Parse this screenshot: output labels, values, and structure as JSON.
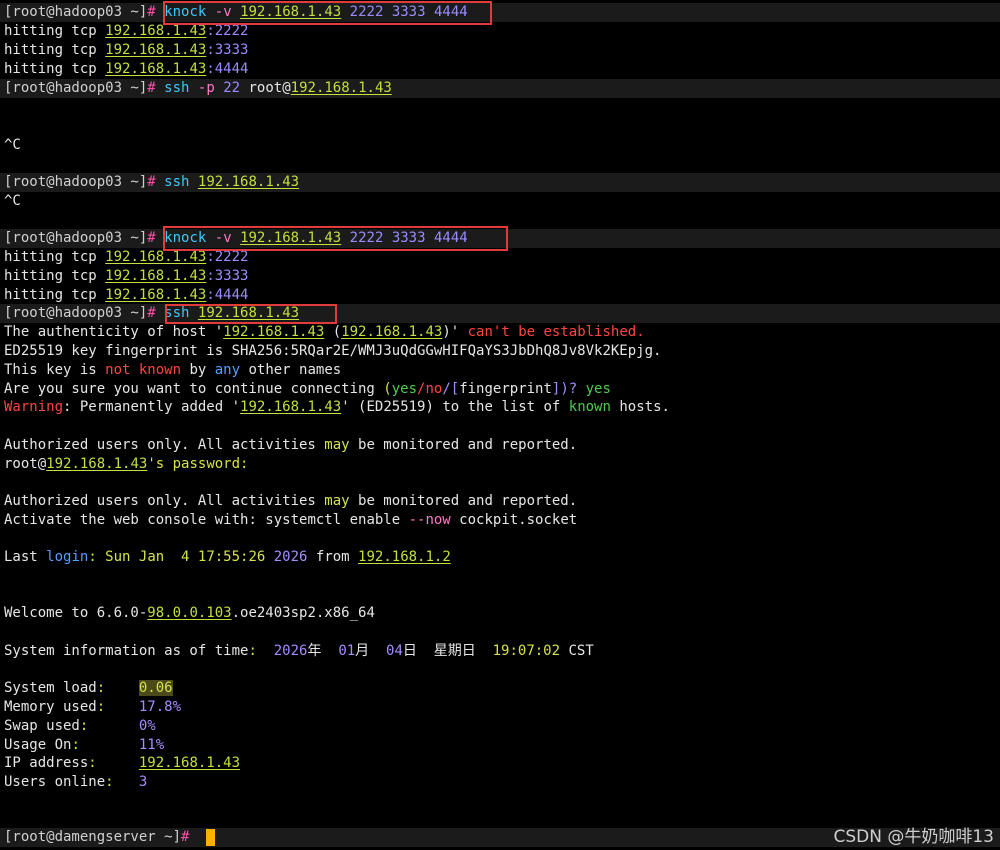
{
  "prompt": {
    "hadoop": "[root@hadoop03 ~]",
    "hash": "#",
    "dameng": "[root@damengserver ~]"
  },
  "commands": {
    "knock1": {
      "cmd": "knock",
      "opt": "-v",
      "ip": "192.168.1.43",
      "ports": [
        "2222",
        "3333",
        "4444"
      ]
    },
    "ssh1": {
      "cmd": "ssh",
      "opt": "-p",
      "port": "22",
      "user": "root@",
      "ip": "192.168.1.43"
    },
    "ssh2": {
      "cmd": "ssh",
      "ip": "192.168.1.43"
    },
    "knock2": {
      "cmd": "knock",
      "opt": "-v",
      "ip": "192.168.1.43",
      "ports": [
        "2222",
        "3333",
        "4444"
      ]
    },
    "ssh3": {
      "cmd": "ssh",
      "ip": "192.168.1.43"
    }
  },
  "hits": {
    "prefix": "hitting tcp ",
    "ip": "192.168.1.43",
    "ports": [
      ":2222",
      ":3333",
      ":4444"
    ]
  },
  "ctrl_c": "^C",
  "auth": {
    "l1_a": "The authenticity of host '",
    "l1_ip1": "192.168.1.43",
    "l1_b": " (",
    "l1_ip2": "192.168.1.43",
    "l1_c": ")' ",
    "l1_d": "can't be established.",
    "l2": "ED25519 key fingerprint is SHA256:5RQar2E/WMJ3uQdGGwHIFQaYS3JbDhQ8Jv8Vk2KEpjg.",
    "l3_a": "This key is ",
    "l3_b": "not known",
    "l3_c": " by ",
    "l3_d": "any",
    "l3_e": " other names",
    "l4_a": "Are you sure you want to continue connecting ",
    "l4_b": "(",
    "l4_yes": "yes",
    "l4_s1": "/",
    "l4_no": "no",
    "l4_s2": "/[",
    "l4_fp": "fingerprint",
    "l4_c": "])? ",
    "l4_ans": "yes",
    "l5_warn": "Warning",
    "l5_a": ": Permanently added '",
    "l5_ip": "192.168.1.43",
    "l5_b": "' (ED25519) to the list of ",
    "l5_known": "known",
    "l5_c": " hosts."
  },
  "banner": {
    "a1": "Authorized users only. All activities ",
    "may": "may",
    "a2": " be monitored and reported.",
    "pw_user": "root@",
    "pw_ip": "192.168.1.43",
    "pw_rest": "'s password:",
    "console_a": "Activate the web console with",
    "console_b": ": systemctl enable ",
    "console_now": "--now",
    "console_c": " cockpit.socket"
  },
  "last_login": {
    "a": "Last ",
    "login": "login",
    "b": ": Sun Jan  4 17:55:26 ",
    "year": "2026",
    "from": " from ",
    "ip": "192.168.1.2"
  },
  "welcome": {
    "a": "Welcome to 6.6.0-",
    "ver": "98.0.0.103",
    "b": ".oe2403sp2.x86_64"
  },
  "sysinfo": {
    "a": "System information as of time",
    "colon": ":  ",
    "year": "2026",
    "nian": "年  ",
    "month": "01",
    "yue": "月  ",
    "day": "04",
    "ri": "日  星期日  ",
    "time": "19:07:02",
    "tz": " CST"
  },
  "stats": [
    {
      "label": "System load",
      "value": "0.06"
    },
    {
      "label": "Memory used",
      "value": "17.8%"
    },
    {
      "label": "Swap used",
      "value": "0%"
    },
    {
      "label": "Usage On",
      "value": "11%"
    },
    {
      "label": "IP address",
      "value": "192.168.1.43"
    },
    {
      "label": "Users online",
      "value": "3"
    }
  ],
  "watermark": "CSDN @牛奶咖啡13"
}
